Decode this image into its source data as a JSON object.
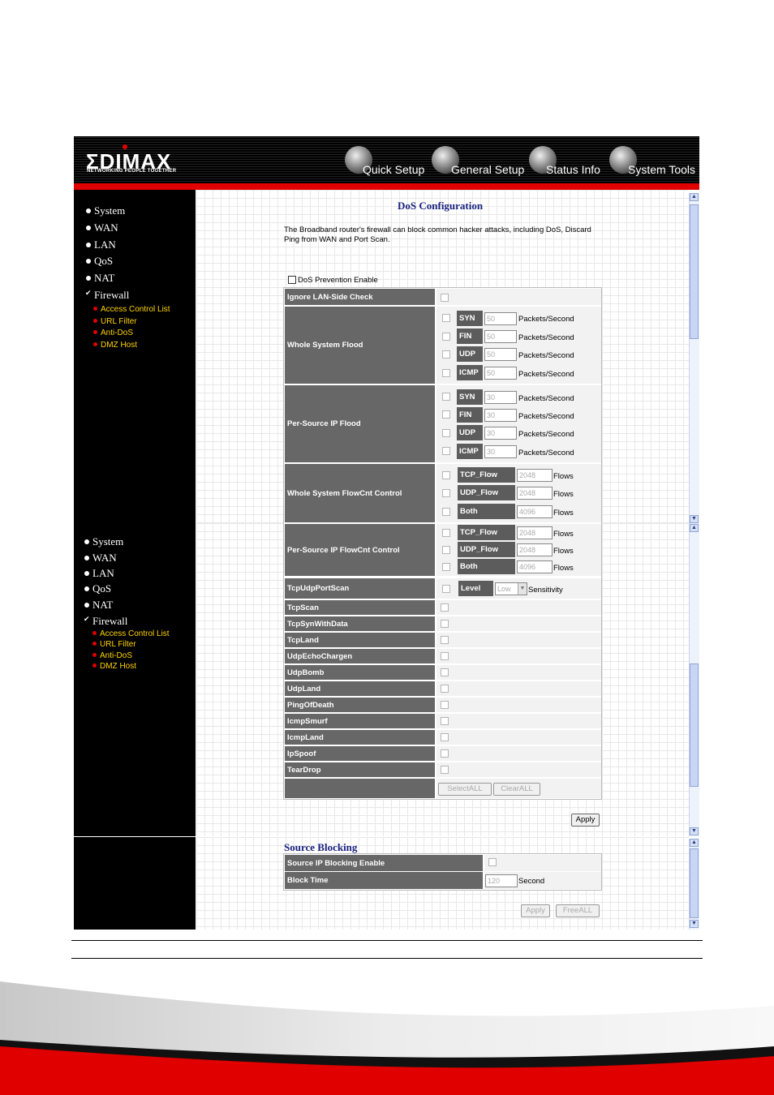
{
  "header": {
    "logo": "ΣDIMAX",
    "tagline": "NETWORKING PEOPLE TOGETHER",
    "nav": [
      "Quick Setup",
      "General Setup",
      "Status Info",
      "System Tools"
    ]
  },
  "sidebar": {
    "items": [
      "System",
      "WAN",
      "LAN",
      "QoS",
      "NAT",
      "Firewall"
    ],
    "sub_items": [
      "Access Control List",
      "URL Filter",
      "Anti-DoS",
      "DMZ Host"
    ]
  },
  "dos": {
    "title": "DoS Configuration",
    "description": "The Broadband router's firewall can block common hacker attacks, including DoS, Discard Ping from WAN and Port Scan.",
    "enable_label": "DoS Prevention Enable",
    "ignore_lan": "Ignore LAN-Side Check",
    "whole_flood": {
      "label": "Whole System Flood",
      "rows": [
        {
          "name": "SYN",
          "value": "50",
          "unit": "Packets/Second"
        },
        {
          "name": "FIN",
          "value": "50",
          "unit": "Packets/Second"
        },
        {
          "name": "UDP",
          "value": "50",
          "unit": "Packets/Second"
        },
        {
          "name": "ICMP",
          "value": "50",
          "unit": "Packets/Second"
        }
      ]
    },
    "per_flood": {
      "label": "Per-Source IP Flood",
      "rows": [
        {
          "name": "SYN",
          "value": "30",
          "unit": "Packets/Second"
        },
        {
          "name": "FIN",
          "value": "30",
          "unit": "Packets/Second"
        },
        {
          "name": "UDP",
          "value": "30",
          "unit": "Packets/Second"
        },
        {
          "name": "ICMP",
          "value": "30",
          "unit": "Packets/Second"
        }
      ]
    },
    "whole_flow": {
      "label": "Whole System FlowCnt Control",
      "rows": [
        {
          "name": "TCP_Flow",
          "value": "2048",
          "unit": "Flows"
        },
        {
          "name": "UDP_Flow",
          "value": "2048",
          "unit": "Flows"
        },
        {
          "name": "Both",
          "value": "4096",
          "unit": "Flows"
        }
      ]
    },
    "per_flow": {
      "label": "Per-Source IP FlowCnt Control",
      "rows": [
        {
          "name": "TCP_Flow",
          "value": "2048",
          "unit": "Flows"
        },
        {
          "name": "UDP_Flow",
          "value": "2048",
          "unit": "Flows"
        },
        {
          "name": "Both",
          "value": "4096",
          "unit": "Flows"
        }
      ]
    },
    "portscan": {
      "label": "TcpUdpPortScan",
      "level_label": "Level",
      "level_value": "Low",
      "unit": "Sensitivity"
    },
    "attacks": [
      "TcpScan",
      "TcpSynWithData",
      "TcpLand",
      "UdpEchoChargen",
      "UdpBomb",
      "UdpLand",
      "PingOfDeath",
      "IcmpSmurf",
      "IcmpLand",
      "IpSpoof",
      "TearDrop"
    ],
    "select_all": "SelectALL",
    "clear_all": "ClearALL",
    "apply": "Apply"
  },
  "source_blocking": {
    "title": "Source Blocking",
    "enable_label": "Source IP Blocking Enable",
    "block_time_label": "Block Time",
    "block_time_value": "120",
    "block_time_unit": "Second",
    "apply": "Apply",
    "free_all": "FreeALL"
  },
  "colors": {
    "accent_red": "#e00000",
    "title_blue": "#1a237e",
    "sub_yellow": "#ffd200"
  }
}
